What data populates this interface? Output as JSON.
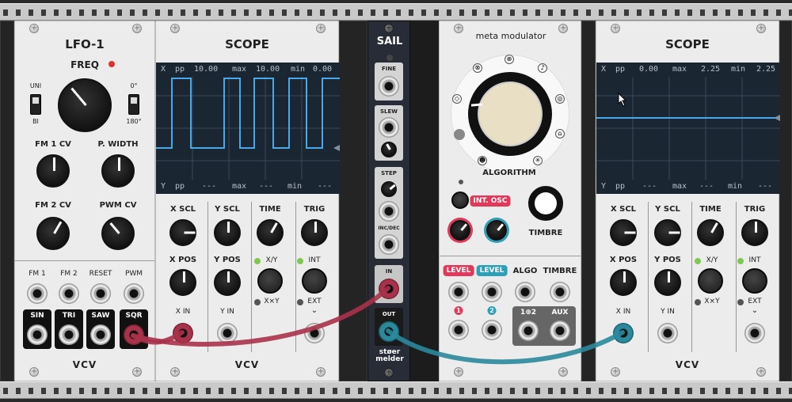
{
  "lfo": {
    "title": "LFO-1",
    "freq_label": "FREQ",
    "uni_label": "UNI",
    "bi_label": "BI",
    "deg0_label": "0°",
    "deg180_label": "180°",
    "fm1cv_label": "FM 1 CV",
    "pwidth_label": "P. WIDTH",
    "fm2cv_label": "FM 2 CV",
    "pwmcv_label": "PWM CV",
    "fm1_label": "FM 1",
    "fm2_label": "FM 2",
    "reset_label": "RESET",
    "pwm_label": "PWM",
    "sin_label": "SIN",
    "tri_label": "TRI",
    "saw_label": "SAW",
    "sqr_label": "SQR",
    "logo": "VCV"
  },
  "scope1": {
    "title": "SCOPE",
    "top_bar": {
      "x": "X",
      "pp": "pp",
      "pp_val": "10.00",
      "max": "max",
      "max_val": "10.00",
      "min": "min",
      "min_val": "0.00"
    },
    "bottom_bar": {
      "y": "Y",
      "pp": "pp",
      "pp_val": "---",
      "max": "max",
      "max_val": "---",
      "min": "min",
      "min_val": "---"
    },
    "xscl_label": "X SCL",
    "yscl_label": "Y SCL",
    "time_label": "TIME",
    "trig_label": "TRIG",
    "xpos_label": "X POS",
    "ypos_label": "Y POS",
    "xy_label": "X/Y",
    "xxy_label": "X×Y",
    "int_label": "INT",
    "ext_label": "EXT",
    "xin_label": "X IN",
    "yin_label": "Y IN",
    "logo": "VCV"
  },
  "sail": {
    "title": "SAIL",
    "fine_label": "FINE",
    "slew_label": "SLEW",
    "step_label": "STEP",
    "incdec_label": "INC/DEC",
    "in_label": "IN",
    "out_label": "OUT",
    "brand": "stoermelder",
    "brand_line1": "støer",
    "brand_line2": "melder"
  },
  "meta": {
    "title": "meta modulator",
    "algorithm_label": "ALGORITHM",
    "int_osc_label": "INT. OSC",
    "timbre_label": "TIMBRE",
    "level1_label": "LEVEL",
    "level2_label": "LEVEL",
    "algo_label": "ALGO",
    "timbre2_label": "TIMBRE",
    "jack1_label": "1",
    "jack2_label": "2",
    "sum_label": "1⊕2",
    "aux_label": "AUX"
  },
  "scope2": {
    "title": "SCOPE",
    "top_bar": {
      "x": "X",
      "pp": "pp",
      "pp_val": "0.00",
      "max": "max",
      "max_val": "2.25",
      "min": "min",
      "min_val": "2.25"
    },
    "bottom_bar": {
      "y": "Y",
      "pp": "pp",
      "pp_val": "---",
      "max": "max",
      "max_val": "---",
      "min": "min",
      "min_val": "---"
    },
    "xscl_label": "X SCL",
    "yscl_label": "Y SCL",
    "time_label": "TIME",
    "trig_label": "TRIG",
    "xpos_label": "X POS",
    "ypos_label": "Y POS",
    "xy_label": "X/Y",
    "xxy_label": "X×Y",
    "int_label": "INT",
    "ext_label": "EXT",
    "xin_label": "X IN",
    "yin_label": "Y IN",
    "logo": "VCV"
  },
  "colors": {
    "cable_red": "#a8324a",
    "cable_teal": "#2a8a9c",
    "scope_trace": "#4aa8e8",
    "led_red": "#e03030",
    "led_green": "#7ec850",
    "pill_red": "#e0395a",
    "pill_teal": "#2e9fb8"
  },
  "icons": [
    "plus-screw-icon",
    "chevron-down-icon",
    "mouse-cursor-icon"
  ]
}
